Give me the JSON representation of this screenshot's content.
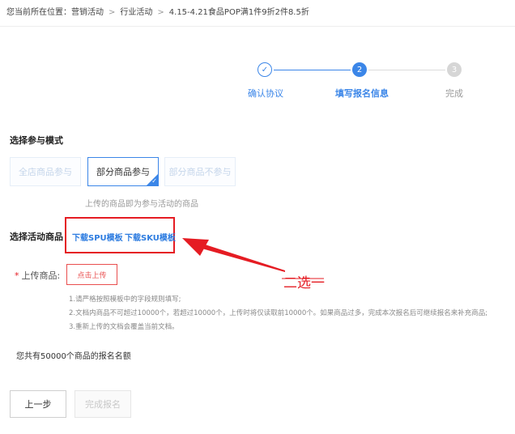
{
  "breadcrumb": {
    "prefix": "您当前所在位置：",
    "items": [
      "营销活动",
      "行业活动",
      "4.15-4.21食品POP满1件9折2件8.5折"
    ],
    "separator": ">"
  },
  "steps": {
    "items": [
      {
        "marker": "✓",
        "label": "确认协议",
        "state": "done"
      },
      {
        "marker": "2",
        "label": "填写报名信息",
        "state": "active"
      },
      {
        "marker": "3",
        "label": "完成",
        "state": "pending"
      }
    ]
  },
  "mode": {
    "title": "选择参与模式",
    "options": [
      {
        "label": "全店商品参与",
        "state": "disabled"
      },
      {
        "label": "部分商品参与",
        "state": "selected"
      },
      {
        "label": "部分商品不参与",
        "state": "disabled"
      }
    ],
    "hint": "上传的商品即为参与活动的商品"
  },
  "goods": {
    "title": "选择活动商品",
    "download_spu": "下载SPU模板",
    "download_sku": "下载SKU模板"
  },
  "upload": {
    "required_mark": "*",
    "label": "上传商品:",
    "button": "点击上传",
    "rules": [
      "1.请严格按照模板中的字段规则填写;",
      "2.文档内商品不可超过10000个，若超过10000个，上传时将仅读取前10000个。如果商品过多，完成本次报名后可继续报名来补充商品;",
      "3.重新上传的文档会覆盖当前文档。"
    ]
  },
  "quota_text": "您共有50000个商品的报名名额",
  "actions": {
    "prev": "上一步",
    "submit": "完成报名"
  },
  "annotation": {
    "text": "二选一",
    "color": "#e51c23"
  },
  "colors": {
    "accent": "#3b86e8",
    "link": "#2d7ce0",
    "danger": "#e51c23"
  }
}
